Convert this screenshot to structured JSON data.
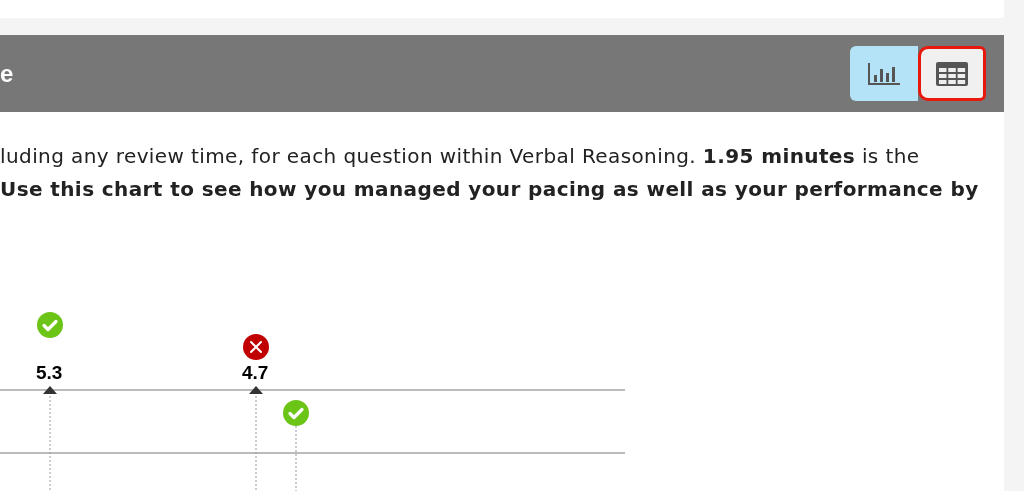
{
  "header": {
    "title": "e",
    "view_toggle": [
      {
        "kind": "chart",
        "selected": true,
        "highlighted": false
      },
      {
        "kind": "table",
        "selected": false,
        "highlighted": true
      }
    ]
  },
  "description": [
    "luding any review time, for each question within Verbal Reasoning. **1.95 minutes** is the",
    "Use this chart to see how you managed your pacing as well as your performance by"
  ],
  "chart": {
    "markers": [
      {
        "kind": "correct",
        "label": "5.3"
      },
      {
        "kind": "incorrect",
        "label": "4.7"
      },
      {
        "kind": "correct"
      }
    ]
  }
}
